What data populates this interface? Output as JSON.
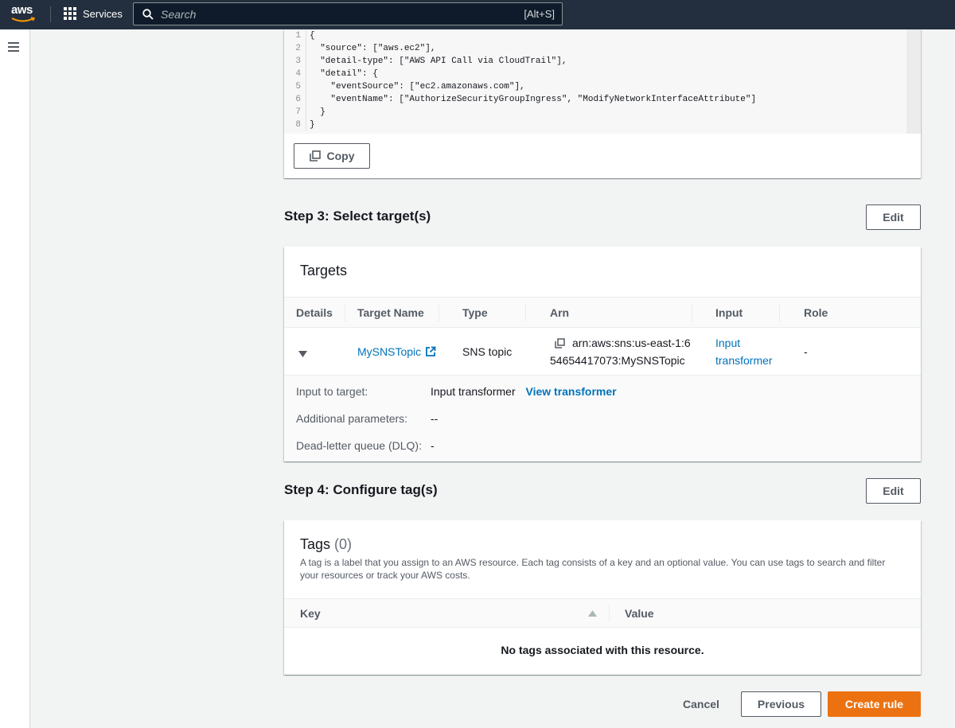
{
  "nav": {
    "logo_text": "aws",
    "services_label": "Services",
    "search_placeholder": "Search",
    "search_shortcut": "[Alt+S]"
  },
  "event_pattern": {
    "lines": [
      {
        "num": "1",
        "text": "{"
      },
      {
        "num": "2",
        "text": "  \"source\": [\"aws.ec2\"],"
      },
      {
        "num": "3",
        "text": "  \"detail-type\": [\"AWS API Call via CloudTrail\"],"
      },
      {
        "num": "4",
        "text": "  \"detail\": {"
      },
      {
        "num": "5",
        "text": "    \"eventSource\": [\"ec2.amazonaws.com\"],"
      },
      {
        "num": "6",
        "text": "    \"eventName\": [\"AuthorizeSecurityGroupIngress\", \"ModifyNetworkInterfaceAttribute\"]"
      },
      {
        "num": "7",
        "text": "  }"
      },
      {
        "num": "8",
        "text": "}"
      }
    ],
    "copy_label": "Copy"
  },
  "step3": {
    "title": "Step 3: Select target(s)",
    "edit_label": "Edit",
    "panel_title": "Targets",
    "columns": [
      "Details",
      "Target Name",
      "Type",
      "Arn",
      "Input",
      "Role"
    ],
    "row": {
      "target_name": "MySNSTopic",
      "type": "SNS topic",
      "arn_line1": "arn:aws:sns:us-east-1:6",
      "arn_line2": "54654417073:MySNSTopic",
      "input_line1": "Input",
      "input_line2": "transformer",
      "role": "-"
    },
    "details": {
      "input_to_target_label": "Input to target:",
      "input_to_target_value": "Input transformer",
      "view_transformer_label": "View transformer",
      "additional_params_label": "Additional parameters:",
      "additional_params_value": "--",
      "dlq_label": "Dead-letter queue (DLQ):",
      "dlq_value": "-"
    }
  },
  "step4": {
    "title": "Step 4: Configure tag(s)",
    "edit_label": "Edit",
    "panel_title": "Tags",
    "tag_count": "(0)",
    "description": "A tag is a label that you assign to an AWS resource. Each tag consists of a key and an optional value. You can use tags to search and filter your resources or track your AWS costs.",
    "columns": [
      "Key",
      "Value"
    ],
    "empty_message": "No tags associated with this resource."
  },
  "footer": {
    "cancel_label": "Cancel",
    "previous_label": "Previous",
    "create_label": "Create rule"
  },
  "colors": {
    "nav_bg": "#232f3e",
    "link": "#0073bb",
    "primary_button": "#ec7211",
    "page_bg": "#f2f3f3"
  }
}
